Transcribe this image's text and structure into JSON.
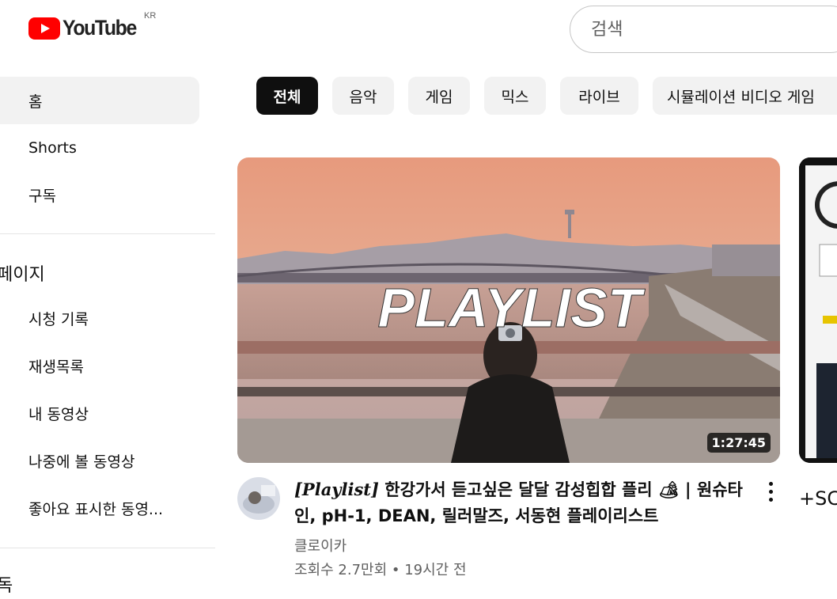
{
  "header": {
    "logo_text": "YouTube",
    "region": "KR",
    "search_placeholder": "검색"
  },
  "sidebar": {
    "items": [
      {
        "label": "홈"
      },
      {
        "label": "Shorts"
      },
      {
        "label": "구독"
      }
    ],
    "section_you": "페이지",
    "you_items": [
      {
        "label": "시청 기록"
      },
      {
        "label": "재생목록"
      },
      {
        "label": "내 동영상"
      },
      {
        "label": "나중에 볼 동영상"
      },
      {
        "label": "좋아요 표시한 동영..."
      }
    ],
    "section_subs": "독"
  },
  "chips": [
    "전체",
    "음악",
    "게임",
    "믹스",
    "라이브",
    "시뮬레이션 비디오 게임"
  ],
  "video": {
    "thumbnail_text": "PLAYLIST",
    "duration": "1:27:45",
    "title_prefix": "[Playlist]",
    "title_rest": " 한강가서 듣고싶은 달달 감성힙합 플리 🏕 | 원슈타인, pH-1, DEAN, 릴러말즈, 서동현 플레이리스트",
    "channel": "클로이카",
    "meta": "조회수 2.7만회 • 19시간 전"
  },
  "next_video": {
    "partial_text": "+SC"
  },
  "colors": {
    "brand_red": "#ff0000",
    "chip_active_bg": "#0f0f0f",
    "chip_bg": "#f2f2f2",
    "secondary_text": "#606060"
  }
}
